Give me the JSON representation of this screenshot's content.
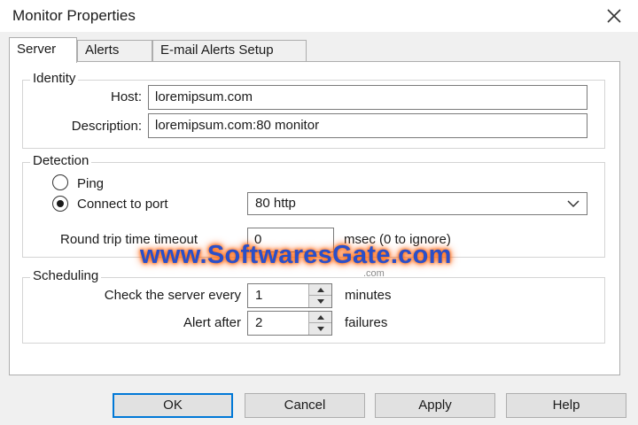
{
  "window": {
    "title": "Monitor Properties"
  },
  "tabs": [
    "Server",
    "Alerts",
    "E-mail Alerts Setup"
  ],
  "identity": {
    "title": "Identity",
    "host_label": "Host:",
    "host_value": "loremipsum.com",
    "description_label": "Description:",
    "description_value": "loremipsum.com:80 monitor"
  },
  "detection": {
    "title": "Detection",
    "ping_label": "Ping",
    "connect_label": "Connect to port",
    "selected": "connect",
    "port_value": "80 http",
    "rtt_label": "Round trip time timeout",
    "rtt_value": "0",
    "rtt_unit": "msec (0 to ignore)"
  },
  "scheduling": {
    "title": "Scheduling",
    "check_label": "Check the server every",
    "check_value": "1",
    "check_unit": "minutes",
    "alert_label": "Alert after",
    "alert_value": "2",
    "alert_unit": "failures"
  },
  "buttons": {
    "ok": "OK",
    "cancel": "Cancel",
    "apply": "Apply",
    "help": "Help"
  },
  "watermark": {
    "text": "www.SoftwaresGate.com",
    "sub": ".com"
  },
  "icons": {
    "close": "close-icon",
    "dropdown": "chevron-down-icon",
    "spin_up": "spin-up-icon",
    "spin_down": "spin-down-icon"
  },
  "colors": {
    "accent": "#0078d7",
    "watermark_text": "#2a4fc9",
    "watermark_glow": "#ff5a00"
  }
}
